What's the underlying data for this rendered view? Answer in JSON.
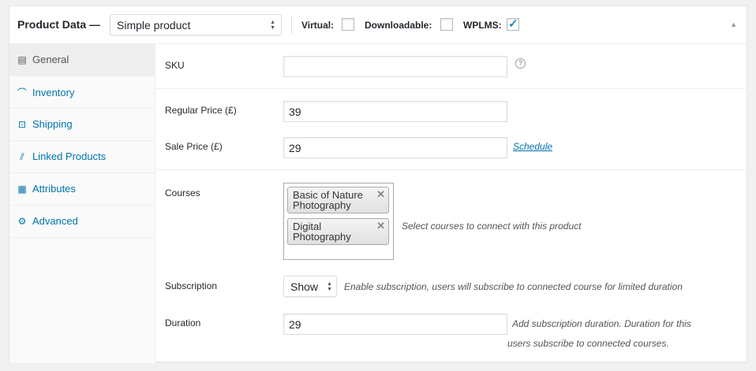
{
  "header": {
    "title": "Product Data —",
    "product_type": "Simple product",
    "options": [
      {
        "label": "Virtual:",
        "checked": false
      },
      {
        "label": "Downloadable:",
        "checked": false
      },
      {
        "label": "WPLMS:",
        "checked": true
      }
    ],
    "collapse_icon": "triangle-up-icon"
  },
  "tabs": [
    {
      "label": "General",
      "icon": "table-icon",
      "active": true
    },
    {
      "label": "Inventory",
      "icon": "chart-icon",
      "active": false
    },
    {
      "label": "Shipping",
      "icon": "cart-icon",
      "active": false
    },
    {
      "label": "Linked Products",
      "icon": "link-icon",
      "active": false
    },
    {
      "label": "Attributes",
      "icon": "list-icon",
      "active": false
    },
    {
      "label": "Advanced",
      "icon": "gear-icon",
      "active": false
    }
  ],
  "fields": {
    "sku": {
      "label": "SKU",
      "value": ""
    },
    "regular_price": {
      "label": "Regular Price (£)",
      "value": "39"
    },
    "sale_price": {
      "label": "Sale Price (£)",
      "value": "29",
      "link": "Schedule"
    },
    "courses": {
      "label": "Courses",
      "selected": [
        {
          "line1": "Basic of Nature",
          "line2": "Photography"
        },
        {
          "line1": "Digital",
          "line2": "Photography"
        }
      ],
      "description": "Select courses to connect with this product"
    },
    "subscription": {
      "label": "Subscription",
      "value": "Show",
      "description": "Enable subscription, users will subscribe to connected course for limited duration"
    },
    "duration": {
      "label": "Duration",
      "value": "29",
      "description_line1": "Add subscription duration. Duration for this",
      "description_line2": "users subscribe to connected courses."
    }
  },
  "colors": {
    "accent": "#0073aa",
    "check": "#1e8cbe"
  }
}
